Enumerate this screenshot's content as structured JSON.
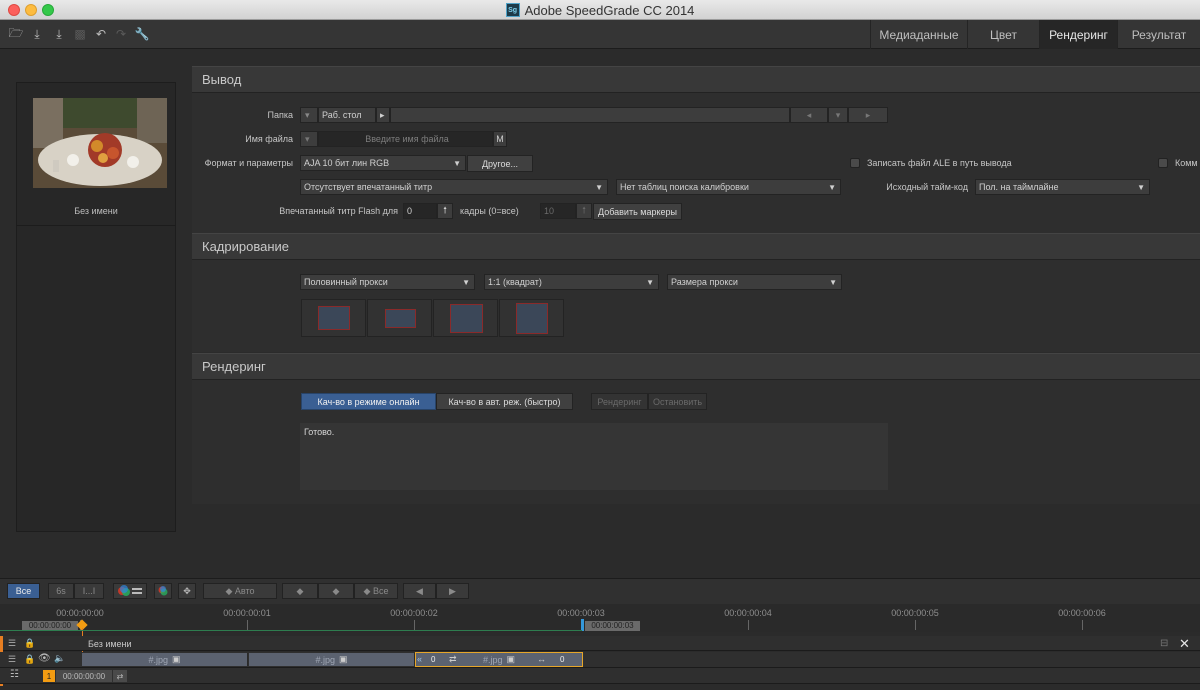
{
  "window": {
    "title": "Adobe SpeedGrade CC 2014",
    "logo_text": "Sg"
  },
  "tabs": [
    {
      "label": "Медиаданные"
    },
    {
      "label": "Цвет"
    },
    {
      "label": "Рендеринг"
    },
    {
      "label": "Результат"
    }
  ],
  "clip": {
    "name": "Без имени"
  },
  "output": {
    "heading": "Вывод",
    "folder_label": "Папка",
    "folder_value": "Раб. стол",
    "filename_label": "Имя файла",
    "filename_placeholder": "Введите имя файла",
    "filename_m": "M",
    "format_label": "Формат и параметры",
    "format_value": "AJA 10 бит лин RGB",
    "other_button": "Другое...",
    "ale_label": "Записать файл ALE в путь вывода",
    "comment_label": "Комм",
    "burnin_value": "Отсутствует впечатанный титр",
    "lut_value": "Нет таблиц поиска калибровки",
    "timecode_label": "Исходный тайм-код",
    "timecode_value": "Пол. на таймлайне",
    "flash_label": "Впечатанный титр Flash для",
    "flash_value": "0",
    "frames_label": "кадры (0=все)",
    "frames_value": "10",
    "add_markers": "Добавить маркеры"
  },
  "crop": {
    "heading": "Кадрирование",
    "proxy_value": "Половинный прокси",
    "aspect_value": "1:1 (квадрат)",
    "size_value": "Размера прокси"
  },
  "render": {
    "heading": "Рендеринг",
    "online_quality": "Кач-во в режиме онлайн",
    "auto_quality": "Кач-во в авт. реж. (быстро)",
    "render_btn": "Рендеринг",
    "stop_btn": "Остановить",
    "status": "Готово."
  },
  "timeline": {
    "all_btn": "Все",
    "six_btn": "6s",
    "bars_btn": "I...I",
    "auto_btn": "Авто",
    "all2_btn": "Все",
    "ruler": [
      "00:00:00:00",
      "00:00:00:01",
      "00:00:00:02",
      "00:00:00:03",
      "00:00:00:04",
      "00:00:00:05",
      "00:00:00:06"
    ],
    "playhead_tc": "00:00:00:00",
    "marker_tc": "00:00:00:03",
    "track_name": "Без имени",
    "clip_labels": [
      "#.jpg",
      "#.jpg",
      "#.jpg"
    ],
    "trim_left": "0",
    "trim_right": "0",
    "track_number": "1",
    "track_tc": "00:00:00:00"
  }
}
